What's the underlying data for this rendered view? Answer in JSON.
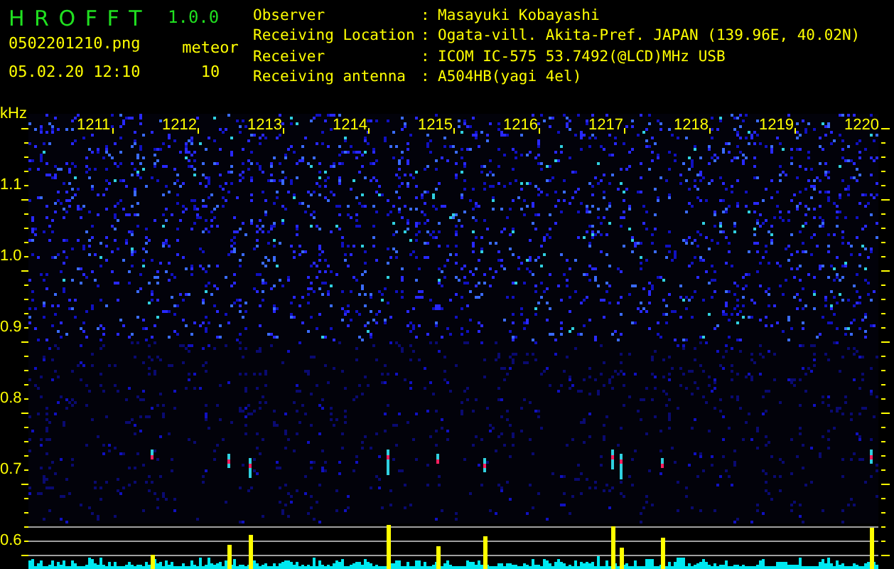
{
  "app": {
    "name": "H R O F F T",
    "version": "1.0.0"
  },
  "file": {
    "name": "0502201210.png",
    "datetime": "05.02.20 12:10"
  },
  "counter": {
    "label": "meteor",
    "value": "10"
  },
  "station": [
    {
      "label": "Observer",
      "separator": ":",
      "value": "Masayuki Kobayashi"
    },
    {
      "label": "Receiving Location",
      "separator": ":",
      "value": "Ogata-vill. Akita-Pref. JAPAN (139.96E, 40.02N)"
    },
    {
      "label": "Receiver",
      "separator": ":",
      "value": "ICOM IC-575 53.7492(@LCD)MHz USB"
    },
    {
      "label": "Receiving antenna",
      "separator": ":",
      "value": "A504HB(yagi 4el)"
    }
  ],
  "spectrogram": {
    "y_unit": "kHz",
    "y_labels": [
      "1.1",
      "1.0",
      "0.9",
      "0.8",
      "0.7",
      "0.6"
    ],
    "time_labels": [
      "1211",
      "1212",
      "1213",
      "1214",
      "1215",
      "1216",
      "1217",
      "1218",
      "1219",
      "1220"
    ]
  }
}
